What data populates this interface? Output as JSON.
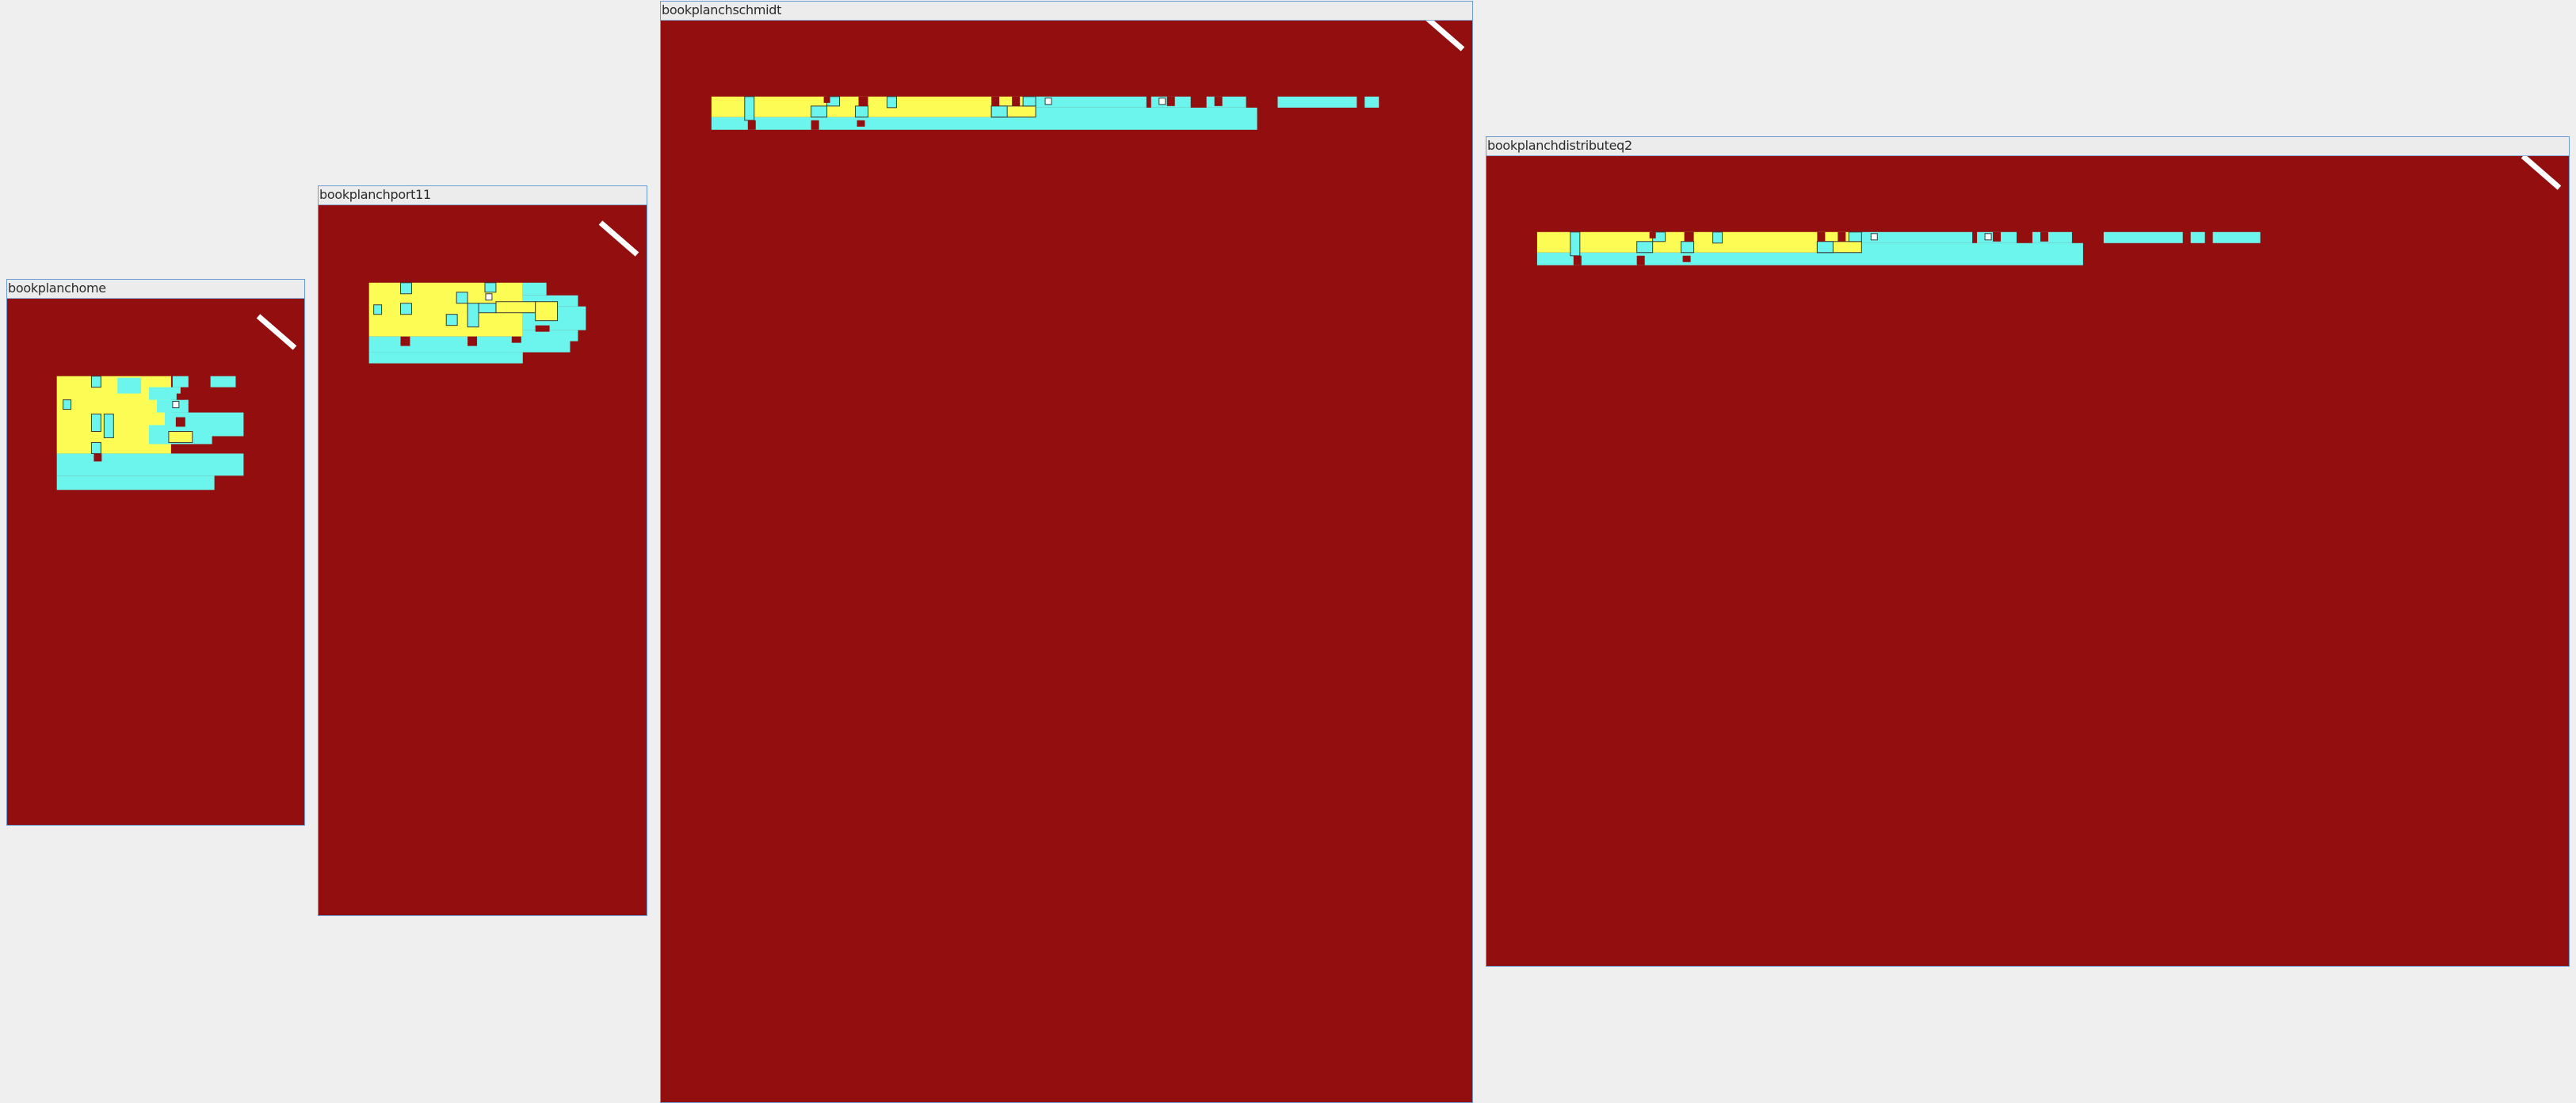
{
  "colors": {
    "background": "#efefef",
    "canvas": "#930e0e",
    "yellow": "#fdfc55",
    "cyan": "#6bf5ec",
    "outline": "#3a3a3a",
    "window_border": "#6c9bd4"
  },
  "windows": [
    {
      "title": "bookplanchome"
    },
    {
      "title": "bookplanchport11"
    },
    {
      "title": "bookplanchschmidt"
    },
    {
      "title": "bookplanchdistributeq2"
    }
  ]
}
